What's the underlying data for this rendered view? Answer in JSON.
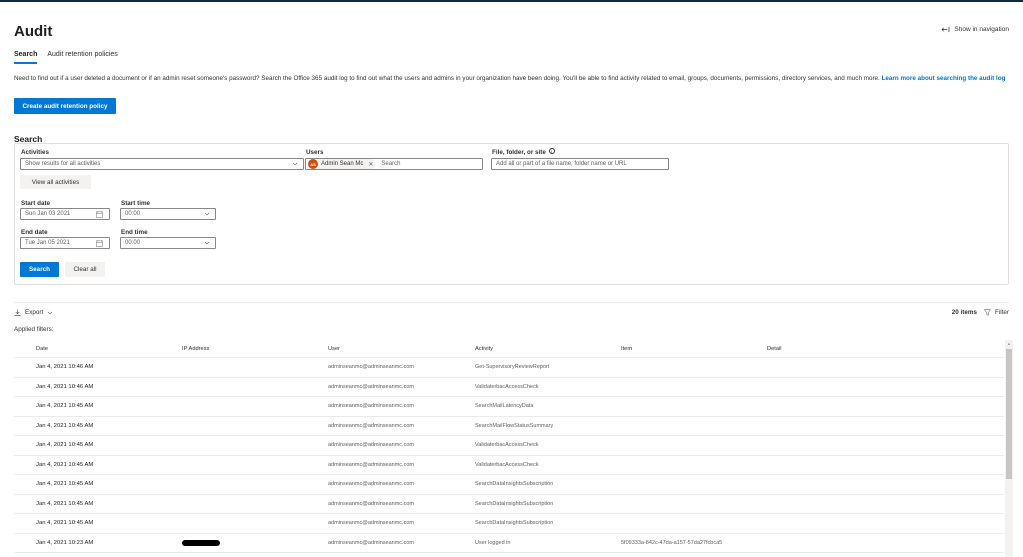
{
  "page": {
    "title": "Audit",
    "show_in_navigation": "Show in navigation"
  },
  "tabs": [
    {
      "label": "Search",
      "active": true
    },
    {
      "label": "Audit retention policies",
      "active": false
    }
  ],
  "description": {
    "text": "Need to find out if a user deleted a document or if an admin reset someone's password? Search the Office 365 audit log to find out what the users and admins in your organization have been doing. You'll be able to find activity related to email, groups, documents, permissions, directory services, and much more. ",
    "link_text": "Learn more about searching the audit log"
  },
  "create_policy_button": "Create audit retention policy",
  "search": {
    "heading": "Search",
    "activities": {
      "label": "Activities",
      "value": "Show results for all activities"
    },
    "view_all_activities_button": "View all activities",
    "users": {
      "label": "Users",
      "chip_initials": "AS",
      "chip_name": "Admin Sean Mc",
      "placeholder": "Search"
    },
    "file_folder_site": {
      "label": "File, folder, or site",
      "info_icon": "i",
      "placeholder": "Add all or part of a file name, folder name or URL"
    },
    "start_date": {
      "label": "Start date",
      "value": "Sun Jan 03 2021"
    },
    "start_time": {
      "label": "Start time",
      "value": "00:00"
    },
    "end_date": {
      "label": "End date",
      "value": "Tue Jan 05 2021"
    },
    "end_time": {
      "label": "End time",
      "value": "00:00"
    },
    "search_button": "Search",
    "clear_all_button": "Clear all"
  },
  "toolbar": {
    "export_label": "Export",
    "items_count": "20 items",
    "filter_label": "Filter"
  },
  "applied_filters_label": "Applied filters:",
  "table": {
    "columns": [
      "Date",
      "IP Address",
      "User",
      "Activity",
      "Item",
      "Detail"
    ],
    "rows": [
      {
        "date": "Jan 4, 2021 10:46 AM",
        "ip": "",
        "user": "adminseanmc@adminseanmc.com",
        "activity": "Get-SupervisoryReviewReport",
        "item": "",
        "detail": ""
      },
      {
        "date": "Jan 4, 2021 10:46 AM",
        "ip": "",
        "user": "adminseanmc@adminseanmc.com",
        "activity": "ValidaterbacAccessCheck",
        "item": "",
        "detail": ""
      },
      {
        "date": "Jan 4, 2021 10:45 AM",
        "ip": "",
        "user": "adminseanmc@adminseanmc.com",
        "activity": "SearchMailLatencyData",
        "item": "",
        "detail": ""
      },
      {
        "date": "Jan 4, 2021 10:45 AM",
        "ip": "",
        "user": "adminseanmc@adminseanmc.com",
        "activity": "SearchMailFlowStatusSummary",
        "item": "",
        "detail": ""
      },
      {
        "date": "Jan 4, 2021 10:45 AM",
        "ip": "",
        "user": "adminseanmc@adminseanmc.com",
        "activity": "ValidaterbacAccessCheck",
        "item": "",
        "detail": ""
      },
      {
        "date": "Jan 4, 2021 10:45 AM",
        "ip": "",
        "user": "adminseanmc@adminseanmc.com",
        "activity": "ValidaterbacAccessCheck",
        "item": "",
        "detail": ""
      },
      {
        "date": "Jan 4, 2021 10:45 AM",
        "ip": "",
        "user": "adminseanmc@adminseanmc.com",
        "activity": "SearchDataInsightsSubscription",
        "item": "",
        "detail": ""
      },
      {
        "date": "Jan 4, 2021 10:45 AM",
        "ip": "",
        "user": "adminseanmc@adminseanmc.com",
        "activity": "SearchDataInsightsSubscription",
        "item": "",
        "detail": ""
      },
      {
        "date": "Jan 4, 2021 10:45 AM",
        "ip": "",
        "user": "adminseanmc@adminseanmc.com",
        "activity": "SearchDataInsightsSubscription",
        "item": "",
        "detail": ""
      },
      {
        "date": "Jan 4, 2021 10:23 AM",
        "ip": "",
        "ip_redacted": true,
        "user": "adminseanmc@adminseanmc.com",
        "activity": "User logged in",
        "item": "5f09333a-842c-47da-a157-57da27fcbca5",
        "detail": ""
      }
    ]
  },
  "icons": {
    "show_nav": "sidebar-arrow-icon",
    "chevron": "chevron-down-icon",
    "calendar": "calendar-icon",
    "export": "download-icon",
    "filter": "filter-funnel-icon"
  },
  "colors": {
    "accent": "#0078d4",
    "avatar": "#ca5010",
    "top_bar": "#0f2a44"
  }
}
